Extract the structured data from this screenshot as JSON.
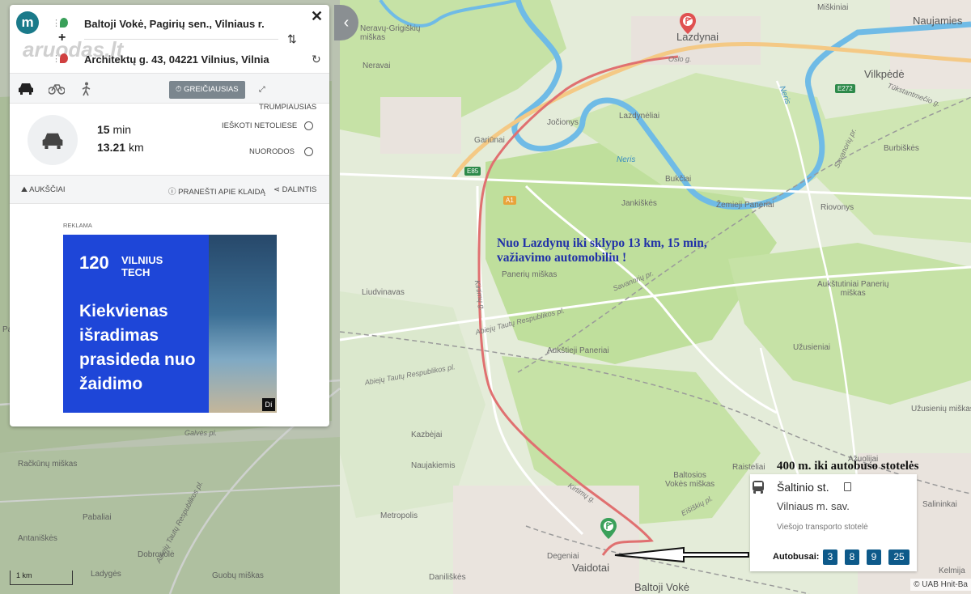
{
  "colors": {
    "accent": "#1a7a8a",
    "route": "#e07070",
    "river": "#5fb0e0",
    "forest": "#bfe0a0",
    "annotation_blue": "#2030a8",
    "bus_badge": "#0e5a8a"
  },
  "route_panel": {
    "logo_letter": "m",
    "from": "Baltoji Vokė, Pagirių sen., Vilniaus r.",
    "to": "Architektų g. 43, 04221 Vilnius, Vilnia",
    "watermark": "aruodas.lt",
    "icons": {
      "close": "close-icon",
      "add": "plus-icon",
      "swap": "swap-icon",
      "loop": "loop-icon"
    },
    "modes": [
      {
        "name": "car",
        "icon": "car-icon",
        "selected": true
      },
      {
        "name": "bike",
        "icon": "bike-icon",
        "selected": false
      },
      {
        "name": "walk",
        "icon": "walk-icon",
        "selected": false
      }
    ],
    "option_fastest": "GREIČIAUSIAS",
    "option_shortest": "TRUMPIAUSIAS",
    "summary": {
      "time_value": "15",
      "time_unit": "min",
      "distance_value": "13.21",
      "distance_unit": "km"
    },
    "search_near": "IEŠKOTI NETOLIESE",
    "directions": "NUORODOS",
    "actions": {
      "elevation": "AUKŠČIAI",
      "report": "PRANEŠTI APIE KLAIDĄ",
      "share": "DALINTIS"
    },
    "ad": {
      "label": "REKLAMA",
      "brand_mark": "120",
      "brand_line1": "VILNIUS",
      "brand_line2": "TECH",
      "headline": "Kiekvienas išradimas prasideda nuo žaidimo",
      "corner": "Dí"
    }
  },
  "map": {
    "labels": {
      "neravai_forest": "Neravų-Grigiškių\nmiškas",
      "neravai": "Neravai",
      "lazdynai": "Lazdynai",
      "miskiniai": "Miškiniai",
      "naujamies": "Naujamies",
      "vilkpede": "Vilkpėdė",
      "oslo": "Oslo g.",
      "tukstantmecio": "Tūkstantmečio g.",
      "joconys": "Jočionys",
      "lazdyneliai": "Lazdynėliai",
      "gariunai": "Gariūnai",
      "neris_1": "Neris",
      "neris_2": "Neris",
      "bukciai": "Bukčiai",
      "burbiskes": "Burbiškės",
      "jankiskes": "Jankiškės",
      "zemieji_paneriai": "Žemieji Paneriai",
      "riovonys": "Riovonys",
      "paneriu_miskas": "Panerių miškas",
      "savanoriu_1": "Savanorių pr.",
      "savanoriu_2": "Savanorių pr.",
      "auksutiniai": "Aukštutiniai Panerių\nmiškas",
      "ludvinavas": "Liudvinavas",
      "abieju_1": "Abiejų Tautų Respublikos pl.",
      "abieju_2": "Abiejų Tautų Respublikos pl.",
      "abieju_3": "Abiejų Tautų Respublikos pl.",
      "kirtimu_1": "Kirtimų g.",
      "kirtimu_2": "Kirtimų g.",
      "auksieji": "Aukštieji Paneriai",
      "uzusieniai": "Užusieniai",
      "uzusieniu_miskas": "Užusienių miškas",
      "kazbejai": "Kazbėjai",
      "naujakiemis": "Naujakiemis",
      "baltosios": "Baltosios\nVokės miškas",
      "azuolijai": "Ažuolijai",
      "raistelai": "Raisteliai",
      "eisiskiu": "Eišiškių pl.",
      "saliniai": "Salininkai",
      "metropolis": "Metropolis",
      "degeniai": "Degeniai",
      "vaidotai": "Vaidotai",
      "daniliskes": "Daniliškės",
      "baltoji_voke": "Baltoji Vokė",
      "kelmija": "Kelmija",
      "galves": "Galvės pl.",
      "rackunu": "Račkūnų miškas",
      "pabaliai": "Pabaliai",
      "antaniskes": "Antaniškės",
      "dobrovole": "Dobrovolė",
      "ladyges": "Ladygės",
      "guobu": "Guobų miškas",
      "pavilnys": "Pavilnys",
      "e85": "E85",
      "a1": "A1",
      "e272": "E272"
    },
    "scale_label": "1 km",
    "attribution": "© UAB Hnit-Ba"
  },
  "annotations": {
    "route_line1": "Nuo Lazdynų iki sklypo 13 km, 15 min,",
    "route_line2": "važiavimo automobiliu !",
    "bus_note": "400 m. iki autobuso stotelės"
  },
  "bus_stop": {
    "name": "Šaltinio st.",
    "municipality": "Vilniaus m. sav.",
    "type": "Viešojo transporto stotelė",
    "buses_label": "Autobusai:",
    "buses": [
      "3",
      "8",
      "9",
      "25"
    ]
  }
}
